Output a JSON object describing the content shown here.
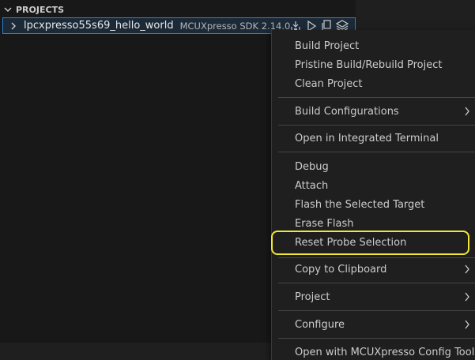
{
  "explorer": {
    "section_title": "PROJECTS",
    "project": {
      "name": "lpcxpresso55s69_hello_world",
      "description": "MCUXpresso SDK 2.14.0"
    },
    "actions": [
      "build-debug-icon",
      "run-icon",
      "copy-icon",
      "layers-icon"
    ]
  },
  "context_menu": {
    "items": [
      {
        "label": "Build Project"
      },
      {
        "label": "Pristine Build/Rebuild Project"
      },
      {
        "label": "Clean Project"
      },
      {
        "label": "Build Configurations",
        "submenu": true
      },
      {
        "label": "Open in Integrated Terminal"
      },
      {
        "label": "Debug"
      },
      {
        "label": "Attach"
      },
      {
        "label": "Flash the Selected Target"
      },
      {
        "label": "Erase Flash"
      },
      {
        "label": "Reset Probe Selection",
        "highlighted": true
      },
      {
        "label": "Copy to Clipboard",
        "submenu": true
      },
      {
        "label": "Project",
        "submenu": true
      },
      {
        "label": "Configure",
        "submenu": true
      },
      {
        "label": "Open with MCUXpresso Config Tools"
      }
    ]
  },
  "colors": {
    "selection_border": "#2b7fd6",
    "highlight_outline": "#f2e733"
  }
}
